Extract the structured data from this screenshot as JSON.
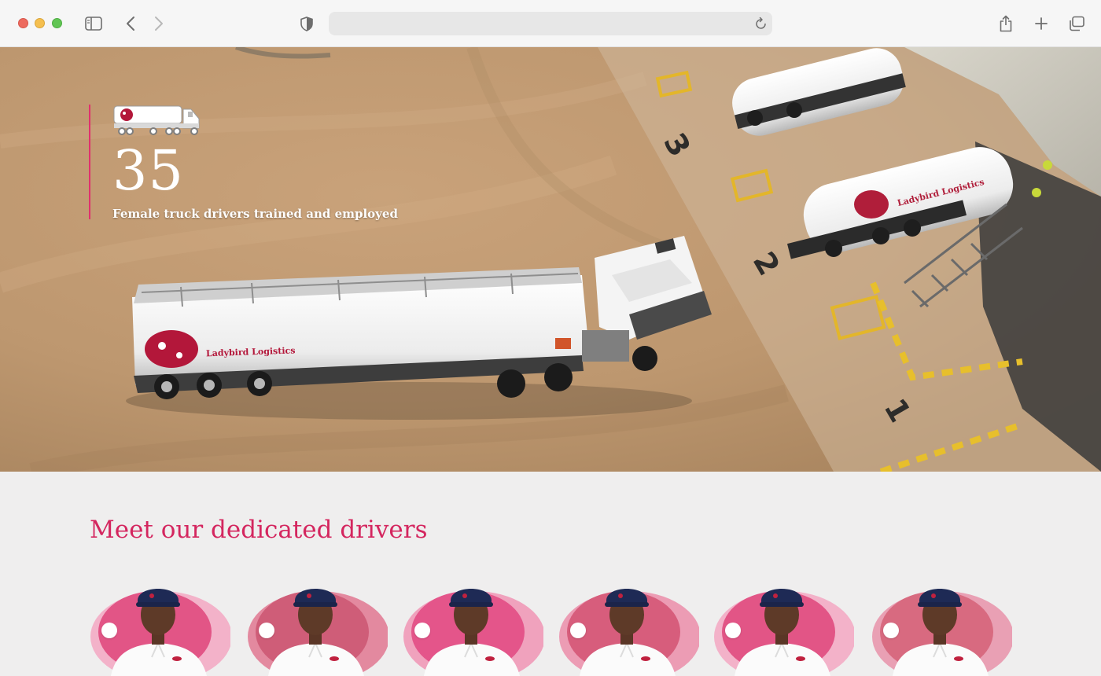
{
  "browser": {
    "url": "",
    "icons": [
      "sidebar-icon",
      "back-icon",
      "forward-icon",
      "shield-icon",
      "reload-icon",
      "share-icon",
      "new-tab-icon",
      "tabs-overview-icon"
    ]
  },
  "hero": {
    "stat_number": "35",
    "stat_caption": "Female truck drivers trained and employed",
    "icon": "tanker-truck-icon",
    "truck_brand": "Ladybird Logistics",
    "bay_numbers": [
      "3",
      "2",
      "1"
    ]
  },
  "drivers": {
    "title": "Meet our dedicated drivers",
    "items": [
      {
        "name": "driver-1"
      },
      {
        "name": "driver-2"
      },
      {
        "name": "driver-3"
      },
      {
        "name": "driver-4"
      },
      {
        "name": "driver-5"
      },
      {
        "name": "driver-6"
      }
    ]
  },
  "colors": {
    "accent": "#d4265f",
    "pink_light": "#f0a6c0",
    "pink_mid": "#e25586",
    "toolbar": "#f6f6f6"
  }
}
